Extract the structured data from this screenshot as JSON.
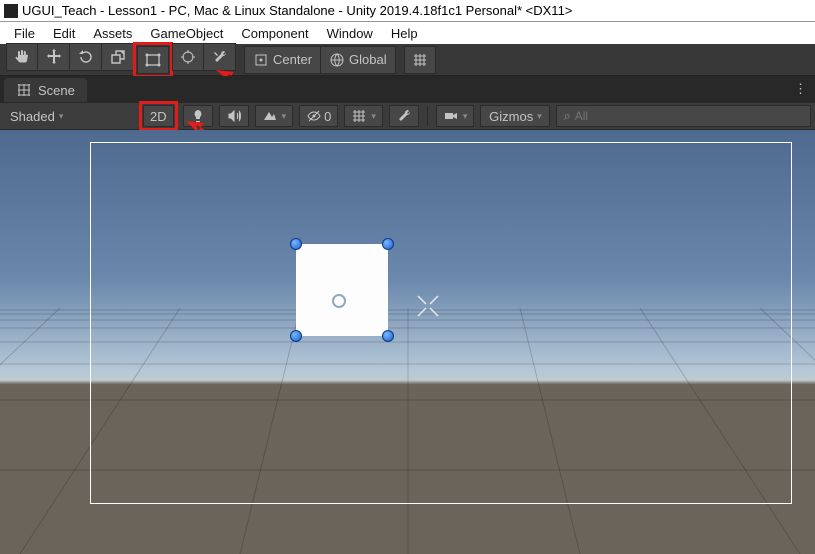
{
  "window": {
    "title": "UGUI_Teach - Lesson1 - PC, Mac & Linux Standalone - Unity 2019.4.18f1c1 Personal* <DX11>"
  },
  "menubar": {
    "items": [
      "File",
      "Edit",
      "Assets",
      "GameObject",
      "Component",
      "Window",
      "Help"
    ]
  },
  "toolbar": {
    "pivot": {
      "label": "Center"
    },
    "space": {
      "label": "Global"
    }
  },
  "tabs": {
    "scene": {
      "label": "Scene"
    }
  },
  "scene_toolbar": {
    "draw_mode": "Shaded",
    "twod": "2D",
    "audio_value": "0",
    "gizmos": "Gizmos",
    "search_placeholder": "All"
  }
}
